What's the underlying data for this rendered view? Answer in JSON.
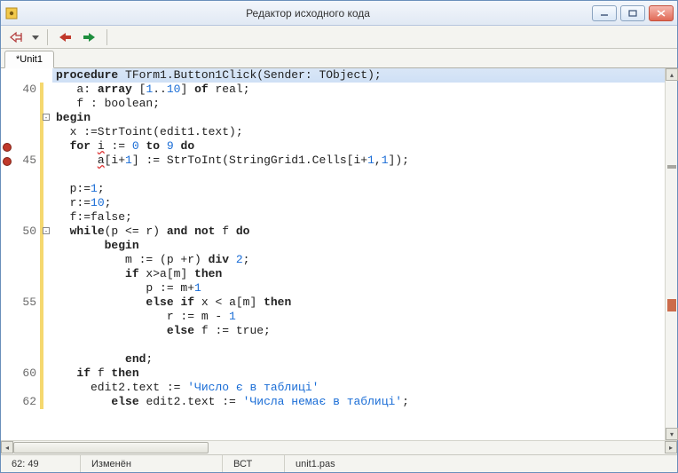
{
  "window": {
    "title": "Редактор исходного кода"
  },
  "tabs": [
    {
      "label": "*Unit1"
    }
  ],
  "gutter": {
    "start": 40,
    "breakpoints": [
      44,
      45
    ]
  },
  "code": {
    "lines": [
      {
        "n": null,
        "hl": true,
        "html": "<span class='kw'>procedure</span> TForm1.Button1Click(Sender: TObject);"
      },
      {
        "n": 40,
        "hl": false,
        "html": "   a: <span class='kw'>array</span> [<span class='num'>1</span>..<span class='num'>10</span>] <span class='kw'>of</span> real;"
      },
      {
        "n": null,
        "hl": false,
        "html": "   f : boolean;"
      },
      {
        "n": null,
        "hl": false,
        "html": "<span class='kw'>begin</span>"
      },
      {
        "n": null,
        "hl": false,
        "html": "  x :=StrToint(edit1.text);"
      },
      {
        "n": null,
        "hl": false,
        "html": "  <span class='kw'>for</span> <span class='err'>i</span> := <span class='num'>0</span> <span class='kw'>to</span> <span class='num'>9</span> <span class='kw'>do</span>"
      },
      {
        "n": 45,
        "hl": false,
        "html": "      <span class='err'>a</span>[i+<span class='num'>1</span>] := StrToInt(StringGrid1.Cells[i+<span class='num'>1</span>,<span class='num'>1</span>]);"
      },
      {
        "n": null,
        "hl": false,
        "html": ""
      },
      {
        "n": null,
        "hl": false,
        "html": "  p:=<span class='num'>1</span>;"
      },
      {
        "n": null,
        "hl": false,
        "html": "  r:=<span class='num'>10</span>;"
      },
      {
        "n": null,
        "hl": false,
        "html": "  f:=false;"
      },
      {
        "n": 50,
        "hl": false,
        "html": "  <span class='kw'>while</span>(p &lt;= r) <span class='kw'>and</span> <span class='kw'>not</span> f <span class='kw'>do</span>"
      },
      {
        "n": null,
        "hl": false,
        "html": "       <span class='kw'>begin</span>"
      },
      {
        "n": null,
        "hl": false,
        "html": "          m := (p +r) <span class='kw'>div</span> <span class='num'>2</span>;"
      },
      {
        "n": null,
        "hl": false,
        "html": "          <span class='kw'>if</span> x&gt;a[m] <span class='kw'>then</span>"
      },
      {
        "n": null,
        "hl": false,
        "html": "             p := m+<span class='num'>1</span>"
      },
      {
        "n": 55,
        "hl": false,
        "html": "             <span class='kw'>else</span> <span class='kw'>if</span> x &lt; a[m] <span class='kw'>then</span>"
      },
      {
        "n": null,
        "hl": false,
        "html": "                r := m - <span class='num'>1</span>"
      },
      {
        "n": null,
        "hl": false,
        "html": "                <span class='kw'>else</span> f := true;"
      },
      {
        "n": null,
        "hl": false,
        "html": ""
      },
      {
        "n": null,
        "hl": false,
        "html": "          <span class='kw'>end</span>;"
      },
      {
        "n": 60,
        "hl": false,
        "html": "   <span class='kw'>if</span> f <span class='kw'>then</span>"
      },
      {
        "n": null,
        "hl": false,
        "html": "     edit2.text := <span class='str'>'Число є в таблиці'</span>"
      },
      {
        "n": 62,
        "hl": false,
        "html": "        <span class='kw'>else</span> edit2.text := <span class='str'>'Числа немає в таблиці'</span>;"
      }
    ]
  },
  "status": {
    "pos": "62: 49",
    "state": "Изменён",
    "insert": "ВСТ",
    "file": "unit1.pas"
  }
}
